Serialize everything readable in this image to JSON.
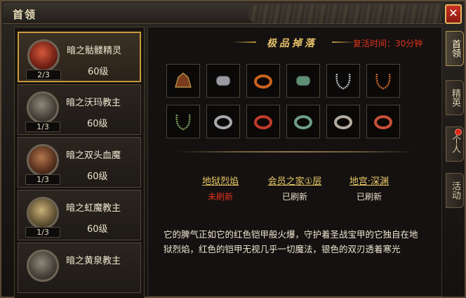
{
  "window": {
    "title": "首领",
    "close_label": "✕"
  },
  "side_tabs": [
    {
      "label": "首领",
      "active": true
    },
    {
      "label": "精英",
      "active": false
    },
    {
      "label": "个人",
      "active": false,
      "has_alert": true
    },
    {
      "label": "活动",
      "active": false
    }
  ],
  "bosses": [
    {
      "name": "暗之骷髅精灵",
      "count": "2/3",
      "level": "60级",
      "selected": true,
      "avatar": "red"
    },
    {
      "name": "暗之沃玛教主",
      "count": "1/3",
      "level": "60级",
      "selected": false,
      "avatar": "grey"
    },
    {
      "name": "暗之双头血魔",
      "count": "1/3",
      "level": "60级",
      "selected": false,
      "avatar": "brown"
    },
    {
      "name": "暗之虹魔教主",
      "count": "1/3",
      "level": "60级",
      "selected": false,
      "avatar": "gold"
    },
    {
      "name": "暗之黄泉教主",
      "count": "",
      "level": "",
      "selected": false,
      "avatar": "grey"
    }
  ],
  "drops": {
    "title": "极品掉落",
    "respawn_text": "复活时间：30分钟",
    "items": [
      {
        "icon": "helmet-icon",
        "color": "#7a3a1e"
      },
      {
        "icon": "bracer-icon",
        "color": "#9a9aa2"
      },
      {
        "icon": "ring-icon",
        "color": "#c9621f"
      },
      {
        "icon": "bracer-icon",
        "color": "#5f8f76"
      },
      {
        "icon": "necklace-icon",
        "color": "#b9b9c0"
      },
      {
        "icon": "necklace-icon",
        "color": "#c6662a"
      },
      {
        "icon": "necklace-icon",
        "color": "#7b9a5a"
      },
      {
        "icon": "ring-icon",
        "color": "#a7a7ad"
      },
      {
        "icon": "ring-icon",
        "color": "#c23a2c"
      },
      {
        "icon": "ring-icon",
        "color": "#6e9e86"
      },
      {
        "icon": "ring-icon",
        "color": "#b2aaa0"
      },
      {
        "icon": "ring-icon",
        "color": "#c8503a"
      }
    ]
  },
  "locations": [
    {
      "name": "地狱烈焰",
      "status": "未刷新",
      "refreshed": false
    },
    {
      "name": "会员之家①层",
      "status": "已刷新",
      "refreshed": true
    },
    {
      "name": "地宫·深渊",
      "status": "已刷新",
      "refreshed": true
    }
  ],
  "description": "它的脾气正如它的红色铠甲般火爆，守护着圣战宝甲的它独自在地狱烈焰，红色的铠甲无视几乎一切魔法，银色的双刃透着寒光"
}
